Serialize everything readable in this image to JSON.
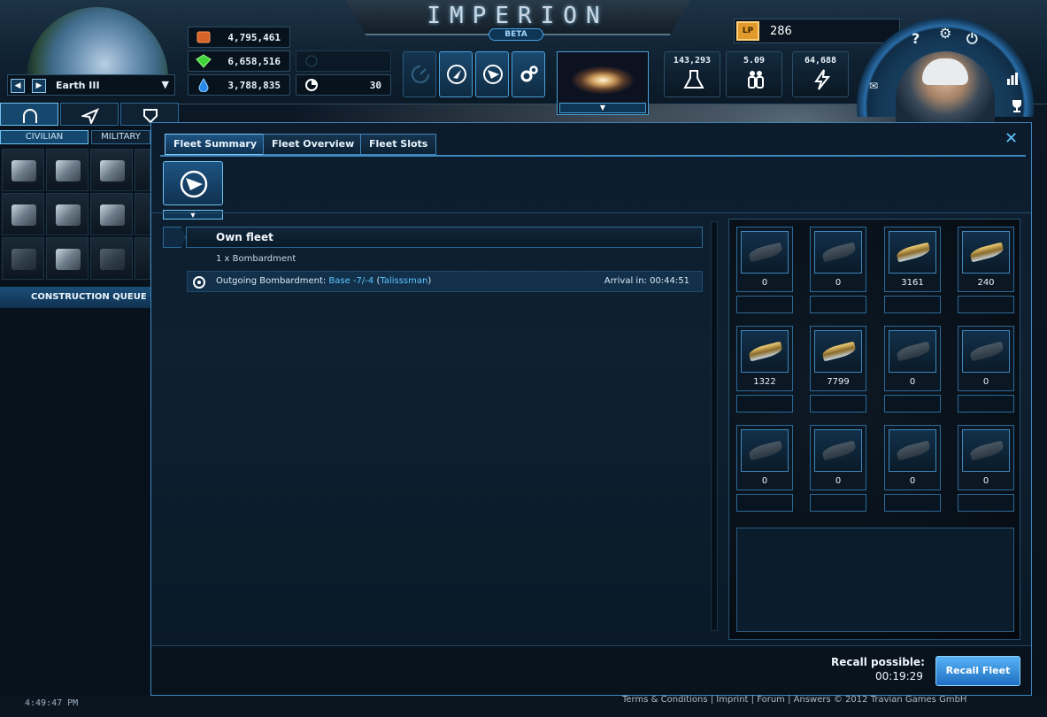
{
  "header": {
    "logo": "IMPERION",
    "beta": "BETA",
    "planet": "Earth III",
    "resources": [
      "4,795,461",
      "6,658,516",
      "3,788,835"
    ],
    "energy": "30",
    "credits": "286",
    "credit_icon": "LP",
    "stats": [
      "143,293",
      "5.09",
      "64,688"
    ]
  },
  "left": {
    "tabs": [
      "CIVILIAN",
      "MILITARY"
    ],
    "construction_queue": "CONSTRUCTION QUEUE"
  },
  "modal": {
    "tabs": [
      "Fleet Summary",
      "Fleet Overview",
      "Fleet Slots"
    ],
    "close": "✕",
    "own_fleet": "Own fleet",
    "fleet_sub": "1 x Bombardment",
    "mission_prefix": "Outgoing Bombardment: ",
    "mission_base": "Base -7/-4",
    "mission_paren_open": " (",
    "mission_player": "Talisssman",
    "mission_paren_close": ")",
    "arrival": "Arrival in: 00:44:51",
    "ships": [
      "0",
      "0",
      "3161",
      "240",
      "1322",
      "7799",
      "0",
      "0",
      "0",
      "0",
      "0",
      "0"
    ],
    "recall_label": "Recall possible:",
    "recall_time": "00:19:29",
    "recall_button": "Recall Fleet"
  },
  "footer": {
    "time": "4:49:47 PM",
    "links": [
      "Terms & Conditions",
      "Imprint",
      "Forum",
      "Answers"
    ],
    "copyright": "© 2012 Travian Games GmbH"
  }
}
